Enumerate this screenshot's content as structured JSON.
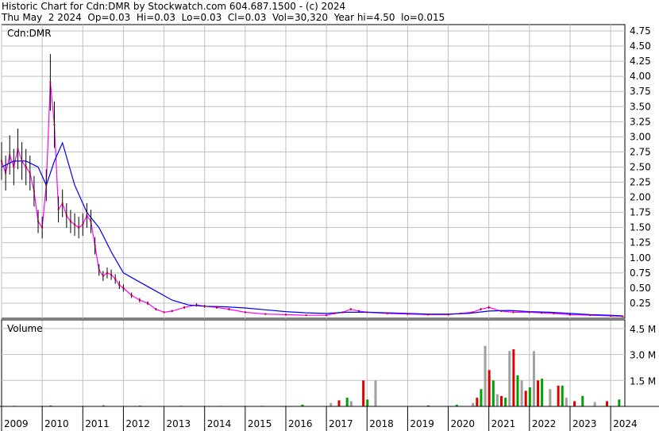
{
  "header": {
    "line1": "Historic Chart for Cdn:DMR by Stockwatch.com 604.687.1500 - (c) 2024",
    "line2": "Thu May  2 2024  Op=0.03  Hi=0.03  Lo=0.03  Cl=0.03  Vol=30,320  Year hi=4.50  lo=0.015"
  },
  "colors": {
    "background": "#ffffff",
    "grid": "#c0c0c0",
    "frame": "#000000",
    "price_bar": "#000000",
    "short_ma": "#ff00ff",
    "long_ma": "#0000ff",
    "marker": "#cc0000",
    "vol_up": "#00a000",
    "vol_down": "#e00000",
    "vol_flat": "#a0a0a0"
  },
  "chart_data": [
    {
      "type": "line",
      "title": "Cdn:DMR",
      "ylim": [
        0,
        4.75
      ],
      "y_ticks": [
        0.25,
        0.5,
        0.75,
        1.0,
        1.25,
        1.5,
        1.75,
        2.0,
        2.25,
        2.5,
        2.75,
        3.0,
        3.25,
        3.5,
        3.75,
        4.0,
        4.25,
        4.5,
        4.75
      ],
      "y_tick_labels": [
        "0.25",
        "0.50",
        "0.75",
        "1.00",
        "1.25",
        "1.50",
        "1.75",
        "2.00",
        "2.25",
        "2.50",
        "2.75",
        "3.00",
        "3.25",
        "3.50",
        "3.75",
        "4.00",
        "4.25",
        "4.50",
        "4.75"
      ],
      "x_tick_labels": [
        "2009",
        "2010",
        "2011",
        "2012",
        "2013",
        "2014",
        "2015",
        "2016",
        "2017",
        "2018",
        "2019",
        "2020",
        "2021",
        "2022",
        "2023",
        "2024"
      ],
      "x_range": [
        2009.0,
        2024.35
      ],
      "grid": true,
      "series": [
        {
          "x": [
            2009.0,
            2009.1,
            2009.2,
            2009.3,
            2009.4,
            2009.5,
            2009.6,
            2009.7,
            2009.8,
            2009.9,
            2010.0,
            2010.1,
            2010.2,
            2010.3,
            2010.4,
            2010.5,
            2010.6,
            2010.7,
            2010.8,
            2010.9,
            2011.0,
            2011.1,
            2011.2,
            2011.3,
            2011.4,
            2011.5,
            2011.6,
            2011.7,
            2011.8,
            2011.9,
            2012.0,
            2012.2,
            2012.4,
            2012.6,
            2012.8,
            2013.0,
            2013.2,
            2013.5,
            2013.8,
            2014.0,
            2014.3,
            2014.6,
            2015.0,
            2015.5,
            2016.0,
            2016.5,
            2017.0,
            2017.2,
            2017.4,
            2017.6,
            2017.8,
            2018.0,
            2018.5,
            2019.0,
            2019.5,
            2020.0,
            2020.3,
            2020.6,
            2020.8,
            2021.0,
            2021.3,
            2021.6,
            2022.0,
            2022.3,
            2022.6,
            2023.0,
            2023.5,
            2024.0,
            2024.3
          ],
          "y": [
            2.6,
            2.4,
            2.7,
            2.5,
            2.8,
            2.6,
            2.5,
            2.4,
            2.1,
            1.6,
            1.5,
            2.2,
            3.9,
            3.2,
            1.8,
            1.9,
            1.7,
            1.6,
            1.55,
            1.5,
            1.55,
            1.7,
            1.6,
            1.2,
            0.8,
            0.7,
            0.75,
            0.72,
            0.65,
            0.55,
            0.5,
            0.38,
            0.3,
            0.25,
            0.15,
            0.1,
            0.12,
            0.18,
            0.22,
            0.2,
            0.18,
            0.15,
            0.1,
            0.07,
            0.06,
            0.05,
            0.05,
            0.08,
            0.1,
            0.15,
            0.12,
            0.1,
            0.08,
            0.07,
            0.06,
            0.06,
            0.08,
            0.1,
            0.15,
            0.18,
            0.12,
            0.1,
            0.1,
            0.09,
            0.08,
            0.06,
            0.05,
            0.04,
            0.03
          ]
        },
        {
          "x": [
            2009.0,
            2009.3,
            2009.6,
            2009.9,
            2010.1,
            2010.3,
            2010.5,
            2010.8,
            2011.1,
            2011.4,
            2011.7,
            2012.0,
            2012.4,
            2012.8,
            2013.2,
            2013.6,
            2014.0,
            2014.5,
            2015.0,
            2015.5,
            2016.0,
            2016.5,
            2017.0,
            2017.5,
            2018.0,
            2018.5,
            2019.0,
            2019.5,
            2020.0,
            2020.5,
            2021.0,
            2021.5,
            2022.0,
            2022.5,
            2023.0,
            2023.5,
            2024.0,
            2024.3
          ],
          "y": [
            2.5,
            2.6,
            2.6,
            2.5,
            2.2,
            2.6,
            2.9,
            2.2,
            1.75,
            1.5,
            1.1,
            0.75,
            0.6,
            0.45,
            0.3,
            0.22,
            0.2,
            0.19,
            0.17,
            0.14,
            0.11,
            0.09,
            0.08,
            0.1,
            0.1,
            0.09,
            0.08,
            0.07,
            0.07,
            0.08,
            0.12,
            0.13,
            0.11,
            0.1,
            0.08,
            0.06,
            0.05,
            0.04
          ]
        }
      ]
    },
    {
      "type": "bar",
      "title": "Volume",
      "ylim": [
        0,
        5.0
      ],
      "y_ticks": [
        1.5,
        3.0,
        4.5
      ],
      "y_tick_labels": [
        "1.5 M",
        "3.0 M",
        "4.5 M"
      ],
      "x": [
        2009.3,
        2010.2,
        2011.5,
        2012.4,
        2013.4,
        2014.4,
        2015.4,
        2016.4,
        2017.1,
        2017.3,
        2017.5,
        2017.6,
        2017.9,
        2018.0,
        2018.2,
        2019.5,
        2020.2,
        2020.6,
        2020.7,
        2020.8,
        2020.9,
        2021.0,
        2021.1,
        2021.2,
        2021.3,
        2021.4,
        2021.5,
        2021.6,
        2021.7,
        2021.8,
        2021.9,
        2022.0,
        2022.1,
        2022.2,
        2022.3,
        2022.5,
        2022.7,
        2022.8,
        2022.9,
        2023.1,
        2023.3,
        2023.6,
        2023.9,
        2024.2
      ],
      "values": [
        0.03,
        0.05,
        0.08,
        0.04,
        0.03,
        0.03,
        0.03,
        0.1,
        0.2,
        0.35,
        0.5,
        0.3,
        1.5,
        0.4,
        1.5,
        0.05,
        0.1,
        0.2,
        0.5,
        1.0,
        3.5,
        2.1,
        1.5,
        0.7,
        0.6,
        0.5,
        3.2,
        3.3,
        1.8,
        1.5,
        0.9,
        1.1,
        3.2,
        1.5,
        1.6,
        1.0,
        1.2,
        1.2,
        0.5,
        0.3,
        0.6,
        0.25,
        0.3,
        0.4
      ]
    }
  ]
}
